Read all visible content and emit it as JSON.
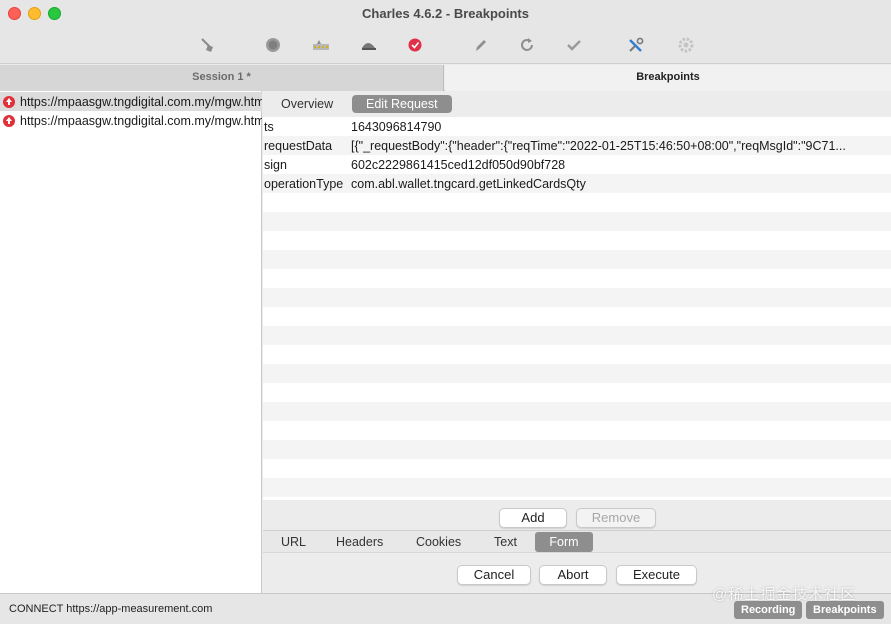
{
  "window": {
    "title": "Charles 4.6.2 - Breakpoints"
  },
  "toolbar": {
    "icons": [
      "broom-icon",
      "record-icon",
      "throttle-icon",
      "turtle-icon",
      "breakpoint-icon",
      "compose-pen-icon",
      "repeat-icon",
      "validate-check-icon",
      "tools-icon",
      "settings-gear-icon"
    ]
  },
  "tabs": {
    "session": "Session 1 *",
    "breakpoints": "Breakpoints"
  },
  "requests": [
    {
      "url": "https://mpaasgw.tngdigital.com.my/mgw.htm"
    },
    {
      "url": "https://mpaasgw.tngdigital.com.my/mgw.htm"
    }
  ],
  "subtabs": {
    "overview": "Overview",
    "edit_request": "Edit Request"
  },
  "form_rows": [
    {
      "key": "ts",
      "value": "1643096814790"
    },
    {
      "key": "requestData",
      "value": "[{\"_requestBody\":{\"header\":{\"reqTime\":\"2022-01-25T15:46:50+08:00\",\"reqMsgId\":\"9C71..."
    },
    {
      "key": "sign",
      "value": "602c2229861415ced12df050d90bf728"
    },
    {
      "key": "operationType",
      "value": "com.abl.wallet.tngcard.getLinkedCardsQty"
    }
  ],
  "form_buttons": {
    "add": "Add",
    "remove": "Remove"
  },
  "bottom_tabs": {
    "url": "URL",
    "headers": "Headers",
    "cookies": "Cookies",
    "text": "Text",
    "form": "Form"
  },
  "actions": {
    "cancel": "Cancel",
    "abort": "Abort",
    "execute": "Execute"
  },
  "status": {
    "text": "CONNECT https://app-measurement.com",
    "recording": "Recording",
    "breakpoints": "Breakpoints"
  },
  "watermark": "@稀土掘金技术社区",
  "colors": {
    "active_tab": "#8e8e8e",
    "breakpoint_red": "#e0303a"
  }
}
